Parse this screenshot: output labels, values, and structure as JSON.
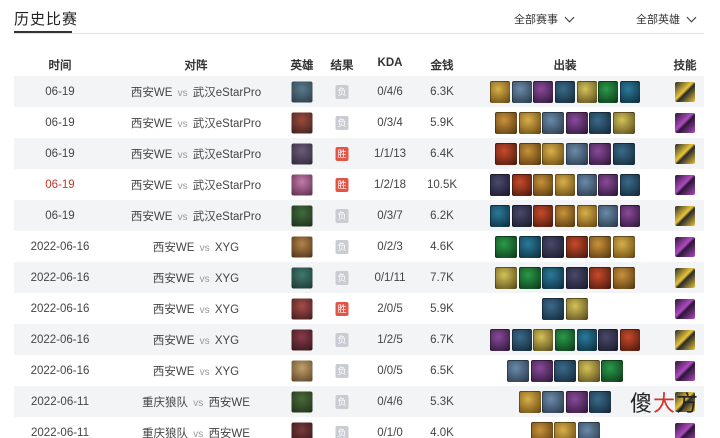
{
  "tab": {
    "title": "历史比赛"
  },
  "filters": {
    "match": "全部赛事",
    "hero": "全部英雄"
  },
  "columns": {
    "time": "时间",
    "matchup": "对阵",
    "hero": "英雄",
    "result": "结果",
    "kda": "KDA",
    "gold": "金钱",
    "items": "出装",
    "skill": "技能"
  },
  "vs_label": "vs",
  "watermark": {
    "a": "傻",
    "b": "大",
    "c": "方"
  },
  "colors": {
    "win": "#e45446",
    "lose": "#c9ccd2",
    "highlight_date": "#c0392b"
  },
  "rows": [
    {
      "date": "06-19",
      "team1": "西安WE",
      "team2": "武汉eStarPro",
      "result": "负",
      "kda": "0/4/6",
      "gold": "6.3K",
      "items": 7,
      "highlight": false
    },
    {
      "date": "06-19",
      "team1": "西安WE",
      "team2": "武汉eStarPro",
      "result": "负",
      "kda": "0/3/4",
      "gold": "5.9K",
      "items": 6,
      "highlight": false
    },
    {
      "date": "06-19",
      "team1": "西安WE",
      "team2": "武汉eStarPro",
      "result": "胜",
      "kda": "1/1/13",
      "gold": "6.4K",
      "items": 6,
      "highlight": false
    },
    {
      "date": "06-19",
      "team1": "西安WE",
      "team2": "武汉eStarPro",
      "result": "胜",
      "kda": "1/2/18",
      "gold": "10.5K",
      "items": 7,
      "highlight": true
    },
    {
      "date": "06-19",
      "team1": "西安WE",
      "team2": "武汉eStarPro",
      "result": "负",
      "kda": "0/3/7",
      "gold": "6.2K",
      "items": 7,
      "highlight": false
    },
    {
      "date": "2022-06-16",
      "team1": "西安WE",
      "team2": "XYG",
      "result": "负",
      "kda": "0/2/3",
      "gold": "4.6K",
      "items": 6,
      "highlight": false
    },
    {
      "date": "2022-06-16",
      "team1": "西安WE",
      "team2": "XYG",
      "result": "负",
      "kda": "0/1/11",
      "gold": "7.7K",
      "items": 6,
      "highlight": false
    },
    {
      "date": "2022-06-16",
      "team1": "西安WE",
      "team2": "XYG",
      "result": "胜",
      "kda": "2/0/5",
      "gold": "5.9K",
      "items": 2,
      "highlight": false
    },
    {
      "date": "2022-06-16",
      "team1": "西安WE",
      "team2": "XYG",
      "result": "负",
      "kda": "1/2/5",
      "gold": "6.7K",
      "items": 7,
      "highlight": false
    },
    {
      "date": "2022-06-16",
      "team1": "西安WE",
      "team2": "XYG",
      "result": "负",
      "kda": "0/0/5",
      "gold": "6.5K",
      "items": 5,
      "highlight": false
    },
    {
      "date": "2022-06-11",
      "team1": "重庆狼队",
      "team2": "西安WE",
      "result": "负",
      "kda": "0/4/6",
      "gold": "5.3K",
      "items": 4,
      "highlight": false
    },
    {
      "date": "2022-06-11",
      "team1": "重庆狼队",
      "team2": "西安WE",
      "result": "负",
      "kda": "0/1/0",
      "gold": "4.0K",
      "items": 3,
      "highlight": false
    }
  ]
}
